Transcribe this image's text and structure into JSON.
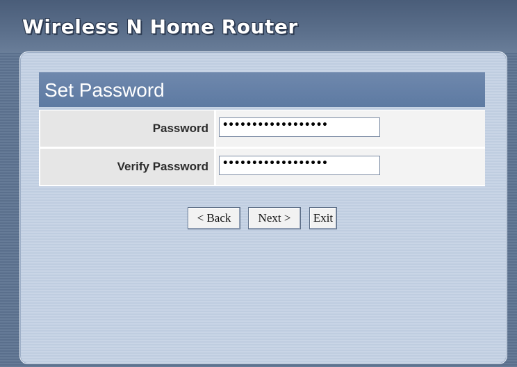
{
  "header": {
    "title": "Wireless N Home Router"
  },
  "section": {
    "title": "Set Password"
  },
  "form": {
    "password": {
      "label": "Password",
      "value": "••••••••••••••••••"
    },
    "verify_password": {
      "label": "Verify Password",
      "value": "••••••••••••••••••"
    }
  },
  "buttons": {
    "back": "< Back",
    "next": "Next >",
    "exit": "Exit"
  },
  "colors": {
    "background": "#5f7491",
    "panel": "#c4d1e3",
    "section_header": "#6582a8",
    "label_cell": "#e6e6e6"
  }
}
